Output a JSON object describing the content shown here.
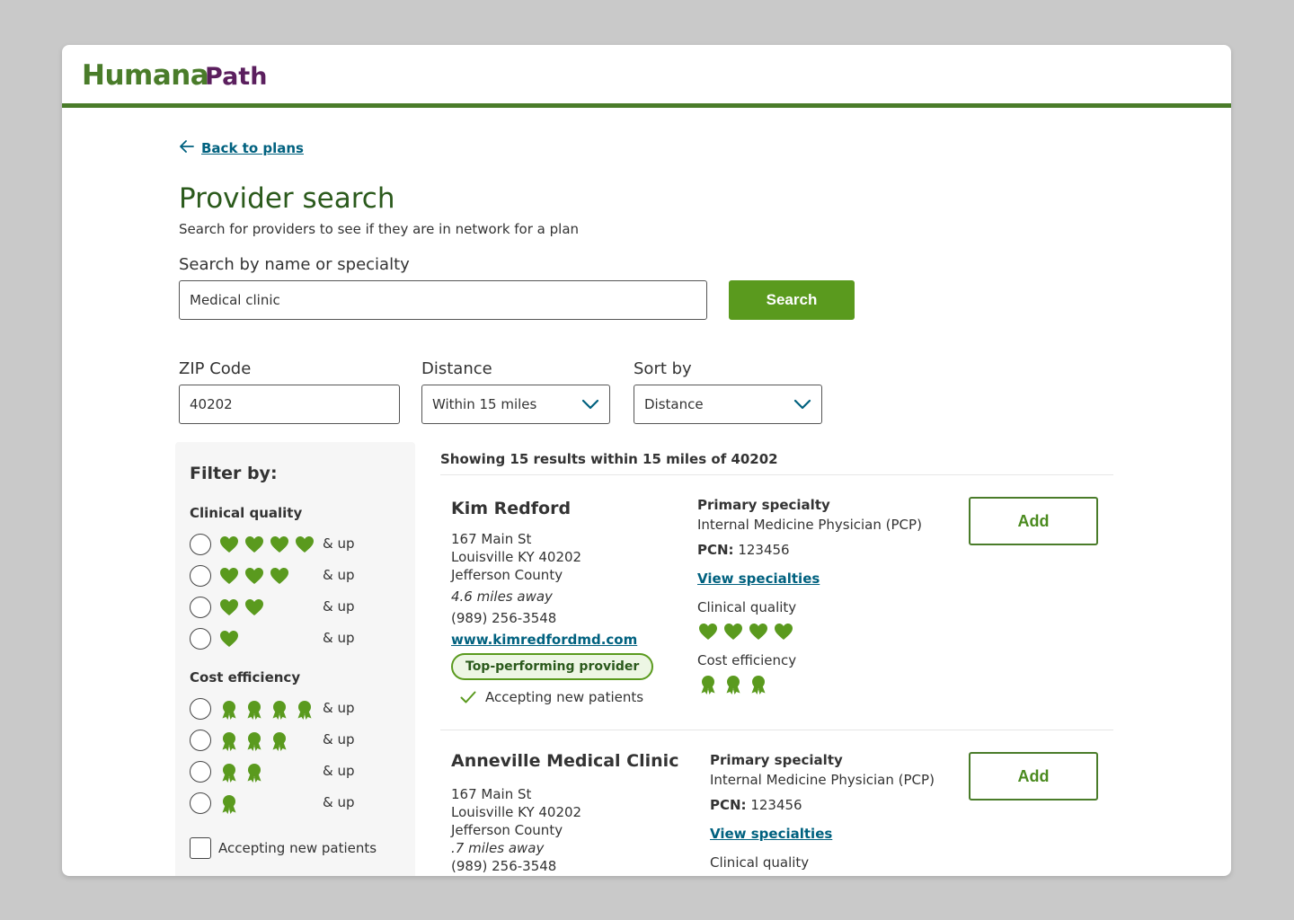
{
  "header": {
    "brand": "Humana",
    "product": "Path"
  },
  "nav": {
    "back_label": "Back to plans"
  },
  "page": {
    "title": "Provider search",
    "subtitle": "Search for providers to see if they are in network for a plan"
  },
  "search": {
    "label": "Search by name or specialty",
    "value": "Medical clinic",
    "button_label": "Search"
  },
  "zip": {
    "label": "ZIP Code",
    "value": "40202"
  },
  "distance": {
    "label": "Distance",
    "selected": "Within 15 miles"
  },
  "sort": {
    "label": "Sort by",
    "selected": "Distance"
  },
  "filters": {
    "title": "Filter by:",
    "clinical_quality": {
      "label": "Clinical quality",
      "options": [
        {
          "rating": 4,
          "suffix": "& up"
        },
        {
          "rating": 3,
          "suffix": "& up"
        },
        {
          "rating": 2,
          "suffix": "& up"
        },
        {
          "rating": 1,
          "suffix": "& up"
        }
      ]
    },
    "cost_efficiency": {
      "label": "Cost efficiency",
      "options": [
        {
          "rating": 4,
          "suffix": "& up"
        },
        {
          "rating": 3,
          "suffix": "& up"
        },
        {
          "rating": 2,
          "suffix": "& up"
        },
        {
          "rating": 1,
          "suffix": "& up"
        }
      ]
    },
    "accepting_label": "Accepting new patients"
  },
  "results": {
    "summary": "Showing 15 results within 15 miles of 40202",
    "providers": [
      {
        "name": "Kim Redford",
        "street": "167 Main St",
        "city_line": "Louisville KY 40202",
        "county": "Jefferson County",
        "distance": "4.6 miles away",
        "phone": "(989) 256-3548",
        "website": "www.kimredfordmd.com",
        "badge": "Top-performing provider",
        "accepting": "Accepting new patients",
        "specialty_label": "Primary specialty",
        "specialty": "Internal Medicine Physician (PCP)",
        "pcn_label": "PCN:",
        "pcn": "123456",
        "view_specialties": "View specialties",
        "clinical_label": "Clinical quality",
        "clinical_rating": 4,
        "cost_label": "Cost efficiency",
        "cost_rating": 3,
        "add_label": "Add"
      },
      {
        "name": "Anneville Medical Clinic",
        "street": "167 Main St",
        "city_line": "Louisville KY 40202",
        "county": "Jefferson County",
        "distance": ".7 miles away",
        "phone": "(989) 256-3548",
        "specialty_label": "Primary specialty",
        "specialty": "Internal Medicine Physician (PCP)",
        "pcn_label": "PCN:",
        "pcn": "123456",
        "view_specialties": "View specialties",
        "clinical_label": "Clinical quality",
        "add_label": "Add"
      }
    ]
  },
  "colors": {
    "brand_green": "#4a7c2a",
    "brand_purple": "#5b1f5e",
    "accent_green": "#5a9a1e",
    "link_teal": "#00617f"
  },
  "icons": {
    "back": "arrow-left-icon",
    "dropdown": "chevron-down-icon",
    "clinical": "heart-icon",
    "cost": "award-ribbon-icon",
    "accepting": "checkmark-icon"
  }
}
